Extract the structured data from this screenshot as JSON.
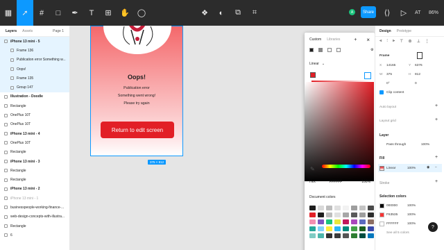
{
  "topbar": {
    "avatar_letter": "A",
    "share_label": "Share",
    "zoom": "86%",
    "at_label": "AT"
  },
  "left_panel": {
    "tabs": {
      "layers": "Layers",
      "assets": "Assets",
      "page": "Page 1"
    },
    "layers": [
      {
        "label": "iPhone 13 mini - 5",
        "level": 0,
        "selected": true,
        "bold": true
      },
      {
        "label": "Frame 136",
        "level": 1,
        "selected": true
      },
      {
        "label": "Publication error Something w...",
        "level": 1,
        "selected": true
      },
      {
        "label": "Oops!",
        "level": 1,
        "selected": true
      },
      {
        "label": "Frame 135",
        "level": 1,
        "selected": true
      },
      {
        "label": "Group 147",
        "level": 1,
        "selected": true
      },
      {
        "label": "Illustration - Doodle",
        "level": 0,
        "bold": true
      },
      {
        "label": "Rectangle",
        "level": 0
      },
      {
        "label": "OnePlus 10T",
        "level": 0
      },
      {
        "label": "OnePlus 10T",
        "level": 0
      },
      {
        "label": "iPhone 13 mini - 4",
        "level": 0,
        "bold": true
      },
      {
        "label": "OnePlus 10T",
        "level": 0
      },
      {
        "label": "Rectangle",
        "level": 0
      },
      {
        "label": "iPhone 13 mini - 3",
        "level": 0,
        "bold": true
      },
      {
        "label": "Rectangle",
        "level": 0
      },
      {
        "label": "Rectangle",
        "level": 0
      },
      {
        "label": "iPhone 13 mini - 2",
        "level": 0,
        "bold": true
      },
      {
        "label": "iPhone 13 mini - 1",
        "level": 0,
        "dim": true
      },
      {
        "label": "businesspeople-working-finance-...",
        "level": 0
      },
      {
        "label": "web-design-concepts-with-illustra...",
        "level": 0
      },
      {
        "label": "Rectangle",
        "level": 0
      },
      {
        "label": "6",
        "level": 0
      }
    ]
  },
  "canvas": {
    "oops": "Oops!",
    "msg1": "Publication error",
    "msg2": "Something went wrong!",
    "msg3": "Please try again",
    "button": "Return to edit screen",
    "size_badge": "375 × 812"
  },
  "color_picker": {
    "tab_custom": "Custom",
    "tab_libraries": "Libraries",
    "fill_type": "Linear",
    "format": "Hex",
    "hex": "FFFFFF",
    "opacity": "100%",
    "doc_colors_label": "Document colors",
    "swatches": [
      "#1e1e1e",
      "#d9d9d9",
      "#bdbdbd",
      "#e0e0e0",
      "#f2f2f2",
      "#9e9e9e",
      "#c4c4c4",
      "#4a4a4a",
      "#e21f26",
      "#1e1e1e",
      "#bdbdbd",
      "#e0e0e0",
      "#a7a7a7",
      "#5a5a5a",
      "#9e9e9e",
      "#2c2c2c",
      "#f48fb1",
      "#7e57c2",
      "#1bc47d",
      "#e8e83c",
      "#c2185b",
      "#ab47bc",
      "#5c6bc0",
      "#8d6e63",
      "#26a69a",
      "#81d4fa",
      "#ffeb3b",
      "#29b6f6",
      "#00897b",
      "#43a047",
      "#1b5e20",
      "#3949ab",
      "#80cbc4",
      "#4db6ac",
      "#333333",
      "#3c3c3c",
      "#555555",
      "#2e7d32",
      "#004d40",
      "#0277bd"
    ],
    "accent": "#0d99ff",
    "selected_red": "#e21f26"
  },
  "right_panel": {
    "tab_design": "Design",
    "tab_prototype": "Prototype",
    "frame_label": "Frame",
    "x_label": "X",
    "x": "14165",
    "y_label": "Y",
    "y": "6376",
    "w_label": "W",
    "w": "375",
    "h_label": "H",
    "h": "812",
    "rot": "0°",
    "radius": "0",
    "clip": "Clip content",
    "auto_layout": "Auto layout",
    "layout_grid": "Layout grid",
    "layer_label": "Layer",
    "blend": "Pass through",
    "layer_opacity": "100%",
    "fill_label": "Fill",
    "fill_type": "Linear",
    "fill_opacity": "100%",
    "stroke_label": "Stroke",
    "selection_colors_label": "Selection colors",
    "colors": [
      {
        "hex": "000000",
        "pct": "100%",
        "color": "#000000"
      },
      {
        "hex": "F63535",
        "pct": "100%",
        "color": "#f63535"
      },
      {
        "hex": "FFFFFF",
        "pct": "100%",
        "color": "#ffffff"
      }
    ],
    "see_all": "See all 5 colors"
  },
  "help": "?"
}
